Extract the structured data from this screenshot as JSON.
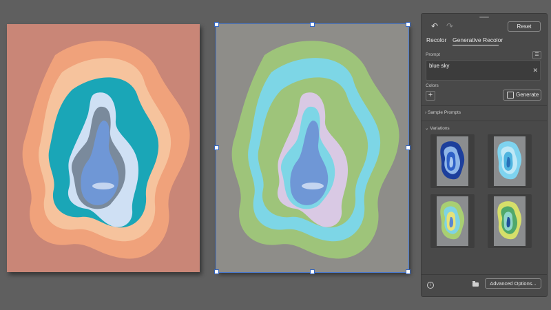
{
  "panel": {
    "reset_label": "Reset",
    "tabs": [
      {
        "label": "Recolor"
      },
      {
        "label": "Generative Recolor"
      }
    ],
    "prompt_label": "Prompt",
    "prompt_value": "blue sky",
    "colors_label": "Colors",
    "add_color_glyph": "+",
    "generate_label": "Generate",
    "sample_prompts_label": "Sample Prompts",
    "variations_label": "Variations",
    "advanced_label": "Advanced Options...",
    "icons": {
      "undo": "undo-icon",
      "redo": "redo-icon",
      "menu": "menu-icon",
      "clear": "close-icon",
      "add": "plus-icon",
      "generate": "generate-icon",
      "chevron_sample": "chevron-right-icon",
      "chevron_variations": "chevron-down-icon",
      "info": "info-icon",
      "folder": "folder-icon"
    }
  },
  "colors": {
    "left_background": "#c98677",
    "right_background": "#8e8d89",
    "selection": "#4a7bd1",
    "panel": "#494949",
    "orange": "#f0a27b",
    "peach": "#f6c39d",
    "teal": "#1aa6b7",
    "pale_blue": "#cfe0f4",
    "slate": "#7a8a9c",
    "sky_blue": "#6f97d6",
    "green": "#9ec47a",
    "cyan": "#7dd6e6",
    "lavender": "#d9c9e4"
  }
}
